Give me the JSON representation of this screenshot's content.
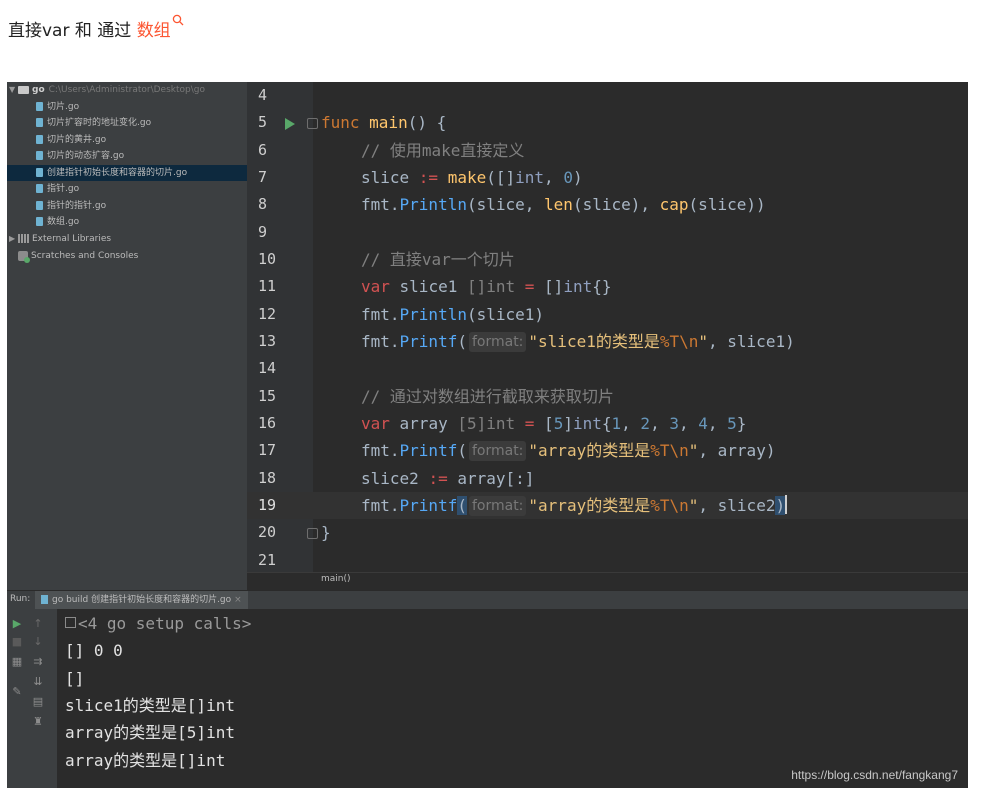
{
  "article": {
    "heading_prefix": "直接var 和 通过 ",
    "heading_link": "数组",
    "link_color": "#fc5531"
  },
  "project_tree": {
    "root_name": "go",
    "root_path": "C:\\Users\\Administrator\\Desktop\\go",
    "files": [
      "切片.go",
      "切片扩容时的地址变化.go",
      "切片的黄井.go",
      "切片的动态扩容.go",
      "创建指针初始长度和容器的切片.go",
      "指针.go",
      "指针的指针.go",
      "数组.go"
    ],
    "selected_index": 4,
    "external_libraries": "External Libraries",
    "scratches": "Scratches and Consoles"
  },
  "editor": {
    "line_numbers": [
      "4",
      "5",
      "6",
      "7",
      "8",
      "9",
      "10",
      "11",
      "12",
      "13",
      "14",
      "15",
      "16",
      "17",
      "18",
      "19",
      "20",
      "21"
    ],
    "current_line": "19",
    "hint_label": "format:",
    "breadcrumb": "main()",
    "code": {
      "l5_func": "func",
      "l5_name": "main",
      "l5_rest": "() {",
      "l6": "// 使用make直接定义",
      "l7_a": "slice ",
      "l7_op": ":=",
      "l7_sp": " ",
      "l7_make": "make",
      "l7_b": "([]",
      "l7_int": "int",
      "l7_c": ", ",
      "l7_num": "0",
      "l7_d": ")",
      "l8_fmt": "fmt.",
      "l8_fn": "Println",
      "l8_a": "(slice, ",
      "l8_len": "len",
      "l8_b": "(slice), ",
      "l8_cap": "cap",
      "l8_c": "(slice))",
      "l10": "// 直接var一个切片",
      "l11_var": "var",
      "l11_a": " slice1 ",
      "l11_t": "[]int",
      "l11_eq": " = ",
      "l11_b": "[]",
      "l11_int": "int",
      "l11_c": "{}",
      "l12_fmt": "fmt.",
      "l12_fn": "Println",
      "l12_a": "(slice1)",
      "l13_fmt": "fmt.",
      "l13_fn": "Printf",
      "l13_a": "(",
      "l13_s1": "\"slice1的类型是",
      "l13_v": "%T\\n",
      "l13_s2": "\"",
      "l13_b": ", slice1)",
      "l15": "// 通过对数组进行截取来获取切片",
      "l16_var": "var",
      "l16_a": " array ",
      "l16_t": "[5]int",
      "l16_eq": " = ",
      "l16_b": "[",
      "l16_5": "5",
      "l16_c": "]",
      "l16_int": "int",
      "l16_d": "{",
      "l16_n1": "1",
      "l16_n2": "2",
      "l16_n3": "3",
      "l16_n4": "4",
      "l16_n5": "5",
      "l16_sep": ", ",
      "l16_e": "}",
      "l17_fmt": "fmt.",
      "l17_fn": "Printf",
      "l17_a": "(",
      "l17_s1": "\"array的类型是",
      "l17_v": "%T\\n",
      "l17_s2": "\"",
      "l17_b": ", array)",
      "l18_a": "slice2 ",
      "l18_op": ":=",
      "l18_b": " array[:]",
      "l19_fmt": "fmt.",
      "l19_fn": "Printf",
      "l19_a": "(",
      "l19_s1": "\"array的类型是",
      "l19_v": "%T\\n",
      "l19_s2": "\"",
      "l19_b": ", slice2",
      "l19_c": ")",
      "l20": "}"
    }
  },
  "run_panel": {
    "label": "Run:",
    "tab_title": "go build 创建指针初始长度和容器的切片.go",
    "output": [
      "<4 go setup calls>",
      "[] 0 0",
      "[]",
      "slice1的类型是[]int",
      "array的类型是[5]int",
      "array的类型是[]int"
    ]
  },
  "watermark": "https://blog.csdn.net/fangkang7",
  "colors": {
    "editor_bg": "#2b2b2b",
    "keyword": "#cc7832",
    "function": "#ffc66d",
    "string": "#e6c07b",
    "number": "#6897bb",
    "comment": "#808080"
  }
}
